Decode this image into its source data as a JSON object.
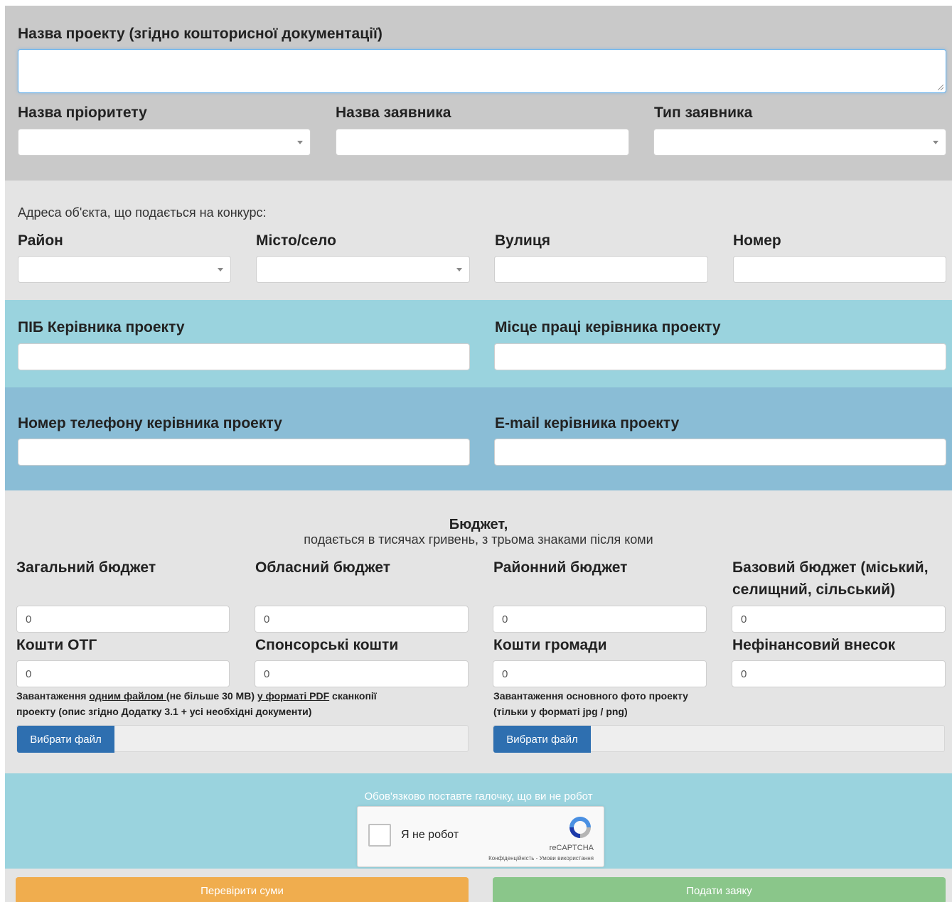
{
  "project": {
    "name_label": "Назва проекту (згідно кошторисної документації)",
    "name_value": "",
    "priority_label": "Назва пріоритету",
    "priority_value": "",
    "applicant_label": "Назва заявника",
    "applicant_value": "",
    "applicant_type_label": "Тип заявника",
    "applicant_type_value": ""
  },
  "address": {
    "intro": "Адреса об'єкта, що подається на конкурс:",
    "district_label": "Район",
    "city_label": "Місто/село",
    "street_label": "Вулиця",
    "number_label": "Номер"
  },
  "manager": {
    "name_label": "ПІБ Керівника проекту",
    "workplace_label": "Місце праці керівника проекту",
    "phone_label": "Номер телефону керівника проекту",
    "email_label": "E-mail керівника проекту"
  },
  "budget": {
    "title": "Бюджет,",
    "subtitle": "подається в тисячах гривень, з трьома знаками після коми",
    "fields": [
      {
        "label": "Загальний бюджет",
        "value": "0"
      },
      {
        "label": "Обласний бюджет",
        "value": "0"
      },
      {
        "label": "Районний бюджет",
        "value": "0"
      },
      {
        "label_line1": "Базовий бюджет (міський,",
        "label_line2": "селищний, сільський)",
        "value": "0"
      },
      {
        "label": "Кошти ОТГ",
        "value": "0"
      },
      {
        "label": "Спонсорські кошти",
        "value": "0"
      },
      {
        "label": "Кошти громади",
        "value": "0"
      },
      {
        "label": "Нефінансовий внесок",
        "value": "0"
      }
    ]
  },
  "uploads": {
    "pdf": {
      "t1": "Завантаження ",
      "t2": "одним файлом ",
      "t3": "(не більше 30 МВ) ",
      "t4": "у форматі PDF",
      "t5": " сканкопії",
      "t6": "проекту (опис згідно Додатку 3.1 + усі необхідні документи)",
      "button": "Вибрати файл"
    },
    "photo": {
      "line1": "Завантаження основного фото проекту",
      "line2": "(тільки у форматі jpg / png)",
      "button": "Вибрати файл"
    }
  },
  "captcha": {
    "hint": "Обов'язково поставте галочку, що ви не робот",
    "label": "Я не робот",
    "brand": "reCAPTCHA",
    "links": "Конфіденційність - Умови використання",
    "checked": false
  },
  "actions": {
    "check_label": "Перевірити суми",
    "submit_label": "Подати заяку"
  },
  "colors": {
    "check_button": "#f0ad4e",
    "submit_button": "#8ac68a",
    "file_button": "#2e6fb0"
  },
  "icons": [
    "dropdown-caret-icon",
    "resize-handle-icon",
    "recaptcha-logo-icon",
    "checkbox-icon"
  ]
}
